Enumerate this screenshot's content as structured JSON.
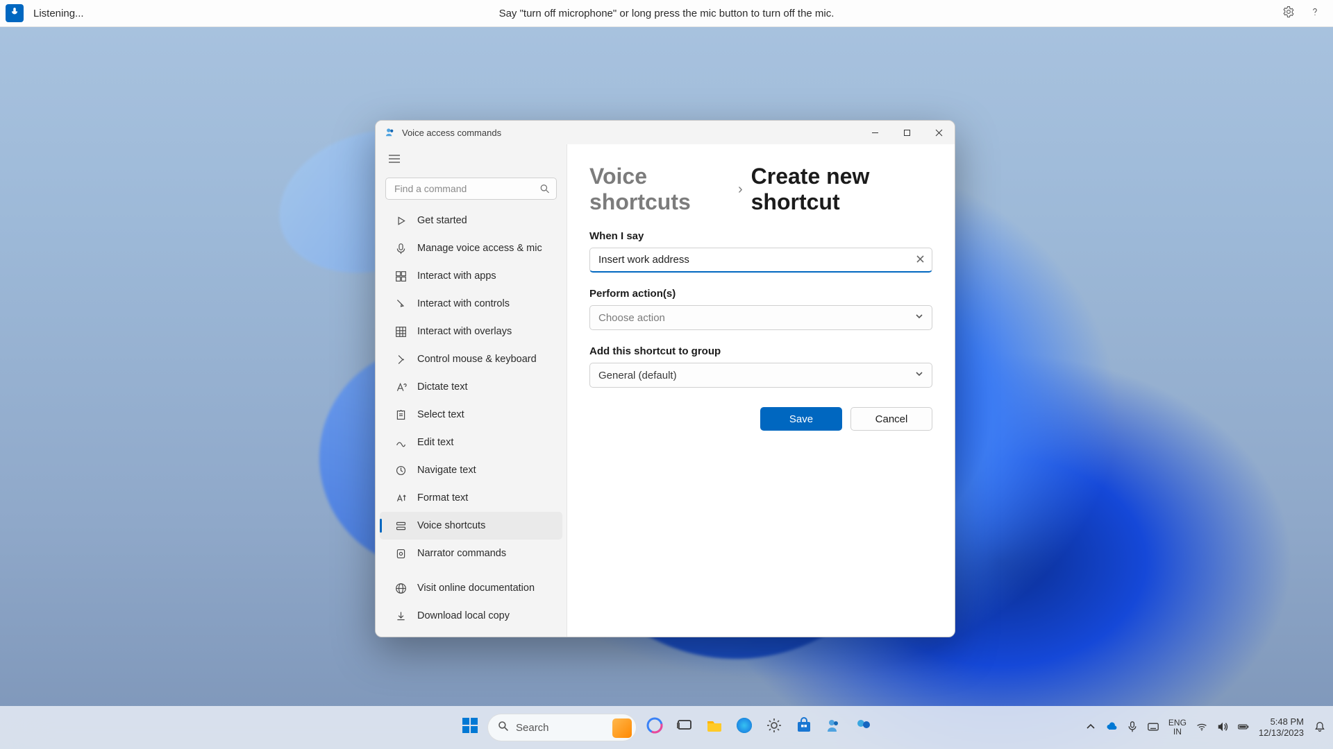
{
  "voice_bar": {
    "status": "Listening...",
    "hint": "Say \"turn off microphone\" or long press the mic button to turn off the mic."
  },
  "window": {
    "title": "Voice access commands",
    "search_placeholder": "Find a command",
    "sidebar": {
      "items": [
        {
          "label": "Get started"
        },
        {
          "label": "Manage voice access & mic"
        },
        {
          "label": "Interact with apps"
        },
        {
          "label": "Interact with controls"
        },
        {
          "label": "Interact with overlays"
        },
        {
          "label": "Control mouse & keyboard"
        },
        {
          "label": "Dictate text"
        },
        {
          "label": "Select text"
        },
        {
          "label": "Edit text"
        },
        {
          "label": "Navigate text"
        },
        {
          "label": "Format text"
        },
        {
          "label": "Voice shortcuts"
        },
        {
          "label": "Narrator commands"
        }
      ],
      "bottom": [
        {
          "label": "Visit online documentation"
        },
        {
          "label": "Download local copy"
        }
      ],
      "selected_index": 11
    }
  },
  "panel": {
    "breadcrumb_parent": "Voice shortcuts",
    "breadcrumb_current": "Create new shortcut",
    "when_i_say": {
      "label": "When I say",
      "value": "Insert work address"
    },
    "perform": {
      "label": "Perform action(s)",
      "placeholder": "Choose action"
    },
    "group": {
      "label": "Add this shortcut to group",
      "value": "General (default)"
    },
    "save": "Save",
    "cancel": "Cancel"
  },
  "taskbar": {
    "search_placeholder": "Search",
    "lang_top": "ENG",
    "lang_bottom": "IN",
    "time": "5:48 PM",
    "date": "12/13/2023"
  }
}
